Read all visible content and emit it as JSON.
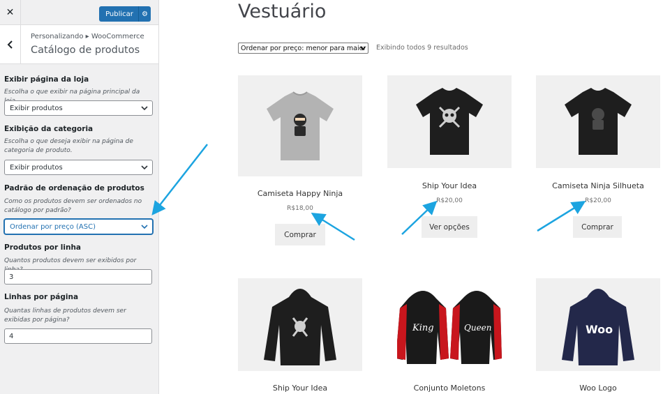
{
  "sidebar": {
    "close_icon": "close-icon",
    "publish_label": "Publicar",
    "publish_settings_icon": "gear-icon",
    "back_icon": "chevron-left-icon",
    "breadcrumb": "Personalizando ▸ WooCommerce",
    "section_title": "Catálogo de produtos",
    "controls": {
      "shop_page": {
        "title": "Exibir página da loja",
        "description": "Escolha o que exibir na página principal da loja.",
        "value": "Exibir produtos"
      },
      "category": {
        "title": "Exibição da categoria",
        "description": "Escolha o que deseja exibir na página de categoria de produto.",
        "value": "Exibir produtos"
      },
      "sorting": {
        "title": "Padrão de ordenação de produtos",
        "description": "Como os produtos devem ser ordenados no catálogo por padrão?",
        "value": "Ordenar por preço (ASC)"
      },
      "per_row": {
        "title": "Produtos por linha",
        "description": "Quantos produtos devem ser exibidos por linha?",
        "value": "3"
      },
      "rows": {
        "title": "Linhas por página",
        "description": "Quantas linhas de produtos devem ser exibidas por página?",
        "value": "4"
      }
    }
  },
  "shop": {
    "title": "Vestuário",
    "orderby_value": "Ordenar por preço: menor para maior",
    "result_count": "Exibindo todos 9 resultados",
    "products": [
      {
        "name": "Camiseta Happy Ninja",
        "price": "R$18,00",
        "button": "Comprar",
        "image": "gray-tshirt-ninja"
      },
      {
        "name": "Ship Your Idea",
        "price": "R$20,00",
        "button": "Ver opções",
        "image": "black-tshirt-skull"
      },
      {
        "name": "Camiseta Ninja Silhueta",
        "price": "R$20,00",
        "button": "Comprar",
        "image": "black-tshirt-ninja-silhouette"
      },
      {
        "name": "Ship Your Idea",
        "image": "black-hoodie-skull"
      },
      {
        "name": "Conjunto Moletons",
        "image": "king-queen-hoodies"
      },
      {
        "name": "Woo Logo",
        "image": "navy-hoodie-woo"
      }
    ]
  },
  "colors": {
    "publish_blue": "#2271b1",
    "annotation_arrow": "#1ca4e0",
    "sidebar_bg": "#f0f0f1"
  }
}
